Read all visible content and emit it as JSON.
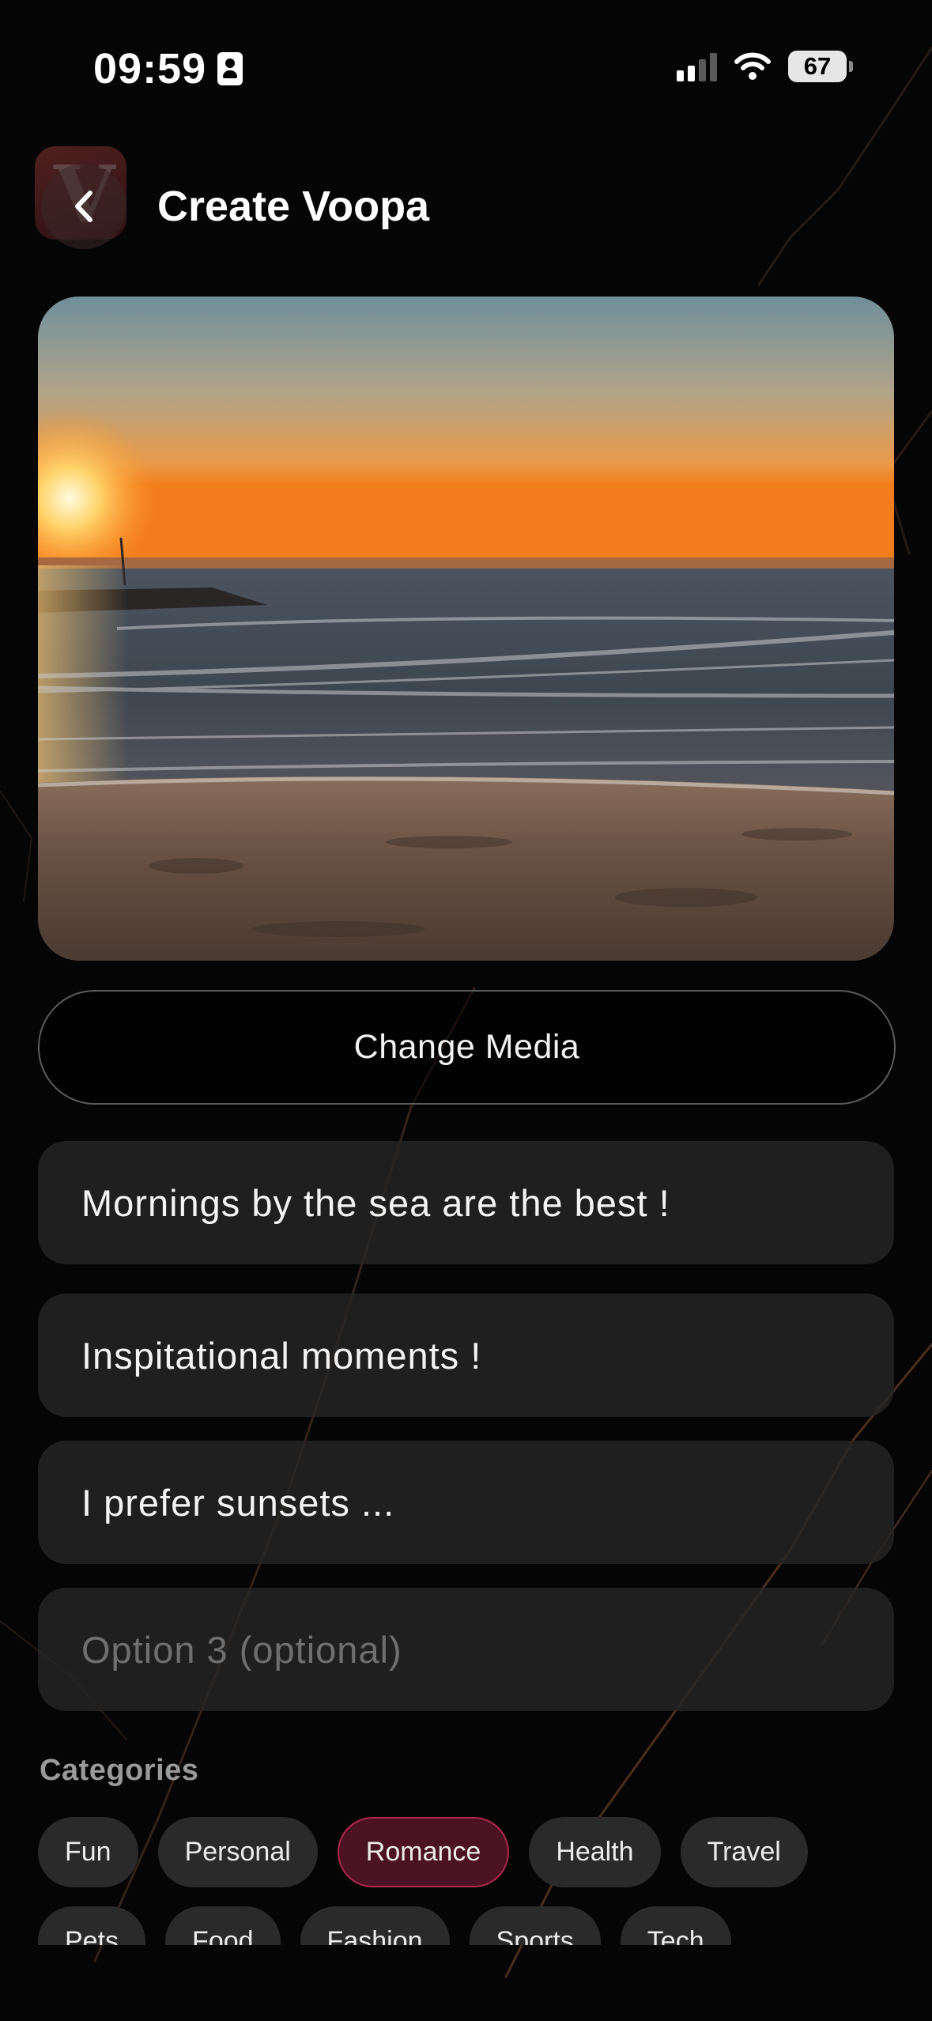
{
  "status_bar": {
    "time": "09:59",
    "battery": "67"
  },
  "header": {
    "title": "Create Voopa"
  },
  "media": {
    "change_label": "Change Media"
  },
  "options": [
    {
      "value": "Mornings by the sea are the best !",
      "placeholder": ""
    },
    {
      "value": "Inspitational moments !",
      "placeholder": ""
    },
    {
      "value": "I prefer sunsets ...",
      "placeholder": ""
    },
    {
      "value": "",
      "placeholder": "Option 3 (optional)"
    }
  ],
  "categories": {
    "label": "Categories",
    "selected": "Romance",
    "items": [
      "Fun",
      "Personal",
      "Romance",
      "Health",
      "Travel",
      "Pets",
      "Food",
      "Fashion",
      "Sports",
      "Tech"
    ]
  },
  "colors": {
    "background": "#050505",
    "field": "#262626",
    "chip": "#2a2a2a",
    "chip_selected_bg": "#4a1222",
    "chip_selected_border": "#b0284e"
  }
}
